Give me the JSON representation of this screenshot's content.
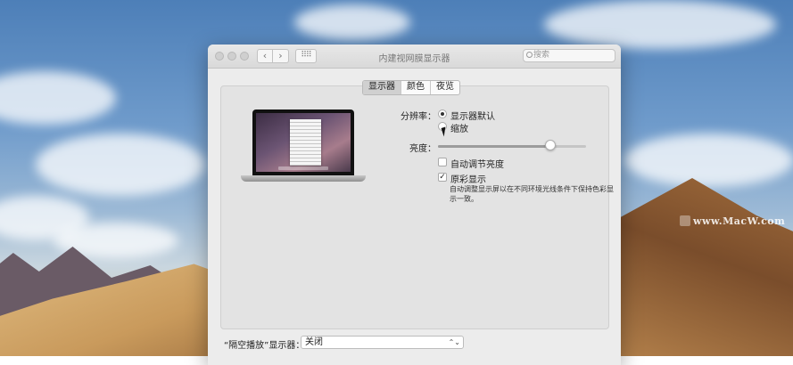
{
  "window": {
    "title": "内建视网膜显示器",
    "search_placeholder": "搜索"
  },
  "tabs": [
    {
      "label": "显示器",
      "selected": true
    },
    {
      "label": "颜色",
      "selected": false
    },
    {
      "label": "夜览",
      "selected": false
    }
  ],
  "display": {
    "resolution_label": "分辨率：",
    "resolution_options": [
      {
        "label": "显示器默认",
        "checked": true
      },
      {
        "label": "缩放",
        "checked": false
      }
    ],
    "brightness_label": "亮度：",
    "brightness_value": 0.76,
    "auto_brightness": {
      "label": "自动调节亮度",
      "checked": false
    },
    "true_tone": {
      "label": "原彩显示",
      "checked": true
    },
    "true_tone_desc": "自动调整显示屏以在不同环境光线条件下保持色彩显示一致。",
    "checkmark": "✓"
  },
  "airplay": {
    "label": "“隔空播放”显示器：",
    "value": "关闭",
    "chevron": "⌃⌄"
  },
  "watermark": {
    "text": "www.MacW.com"
  },
  "icons": {
    "back": "‹",
    "forward": "›",
    "grid": "⠿⠿"
  },
  "colors": {
    "window_bg": "#ececec",
    "panel_bg": "#e3e3e3"
  }
}
